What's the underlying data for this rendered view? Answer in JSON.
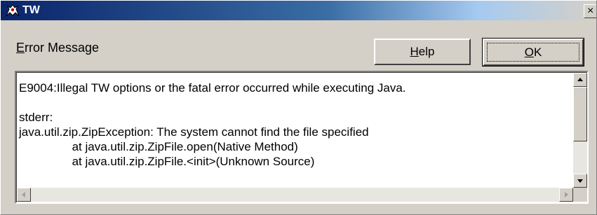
{
  "window": {
    "title": "TW",
    "close_glyph": "×",
    "icon": "tw-app-icon"
  },
  "dialog": {
    "label": "Error Message",
    "label_mnemonic": "E",
    "label_rest": "rror Message"
  },
  "buttons": {
    "help": {
      "mnemonic": "H",
      "rest": "elp",
      "label": "Help"
    },
    "ok": {
      "mnemonic": "O",
      "rest": "K",
      "label": "OK"
    }
  },
  "message": {
    "lines": [
      "E9004:Illegal TW options or the fatal error occurred while executing Java.",
      "",
      "stderr:",
      "java.util.zip.ZipException: The system cannot find the file specified",
      "                at java.util.zip.ZipFile.open(Native Method)",
      "                at java.util.zip.ZipFile.<init>(Unknown Source)"
    ],
    "line_1": "E9004:Illegal TW options or the fatal error occurred while executing Java.",
    "line_2": "",
    "line_3": "stderr:",
    "line_4": "java.util.zip.ZipException: The system cannot find the file specified",
    "line_5": "                at java.util.zip.ZipFile.open(Native Method)",
    "line_6": "                at java.util.zip.ZipFile.<init>(Unknown Source)"
  },
  "colors": {
    "title_start": "#0a246a",
    "title_end": "#a6caf0",
    "face": "#d4d0c8"
  }
}
